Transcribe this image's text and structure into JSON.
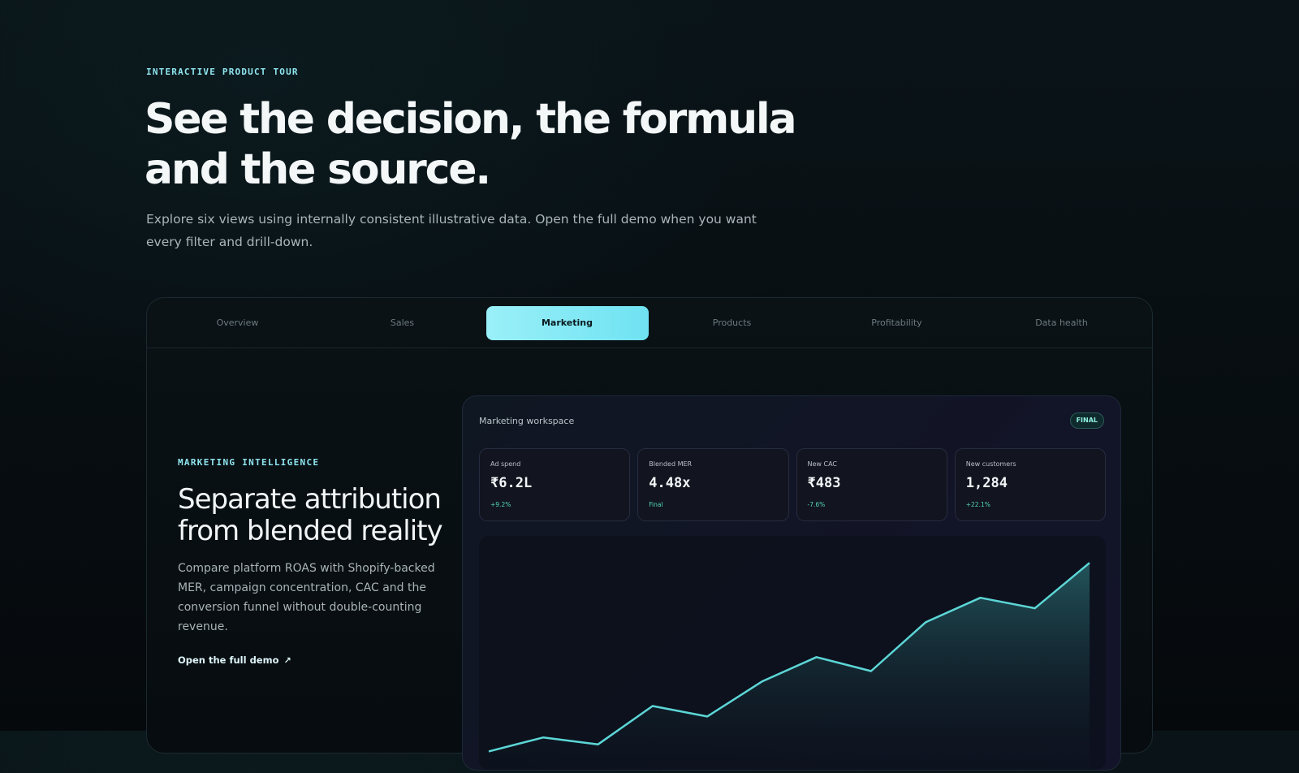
{
  "hero": {
    "eyebrow": "INTERACTIVE PRODUCT TOUR",
    "title": "See the decision, the formula and the source.",
    "subtitle": "Explore six views using internally consistent illustrative data. Open the full demo when you want every filter and drill-down."
  },
  "tabs": [
    {
      "label": "Overview",
      "active": false
    },
    {
      "label": "Sales",
      "active": false
    },
    {
      "label": "Marketing",
      "active": true
    },
    {
      "label": "Products",
      "active": false
    },
    {
      "label": "Profitability",
      "active": false
    },
    {
      "label": "Data health",
      "active": false
    }
  ],
  "section": {
    "eyebrow": "MARKETING INTELLIGENCE",
    "title": "Separate attribution from blended reality",
    "description": "Compare platform ROAS with Shopify-backed MER, campaign concentration, CAC and the conversion funnel without double-counting revenue.",
    "link_label": "Open the full demo",
    "link_icon": "arrow-up-right-icon"
  },
  "workspace": {
    "title": "Marketing workspace",
    "badge": "FINAL",
    "kpis": [
      {
        "label": "Ad spend",
        "value": "₹6.2L",
        "delta": "+9.2%"
      },
      {
        "label": "Blended MER",
        "value": "4.48x",
        "delta": "Final"
      },
      {
        "label": "New CAC",
        "value": "₹483",
        "delta": "-7.6%"
      },
      {
        "label": "New customers",
        "value": "1,284",
        "delta": "+22.1%"
      }
    ]
  },
  "colors": {
    "accent": "#7fe8f4",
    "line": "#5cd6d6",
    "positive": "#54d8b8"
  },
  "chart_data": {
    "type": "area",
    "x": [
      1,
      2,
      3,
      4,
      5,
      6,
      7,
      8,
      9,
      10,
      11,
      12
    ],
    "values": [
      4,
      12,
      8,
      30,
      24,
      44,
      58,
      50,
      78,
      92,
      86,
      112
    ],
    "ylim": [
      0,
      120
    ],
    "grid": false,
    "legend": "none"
  }
}
